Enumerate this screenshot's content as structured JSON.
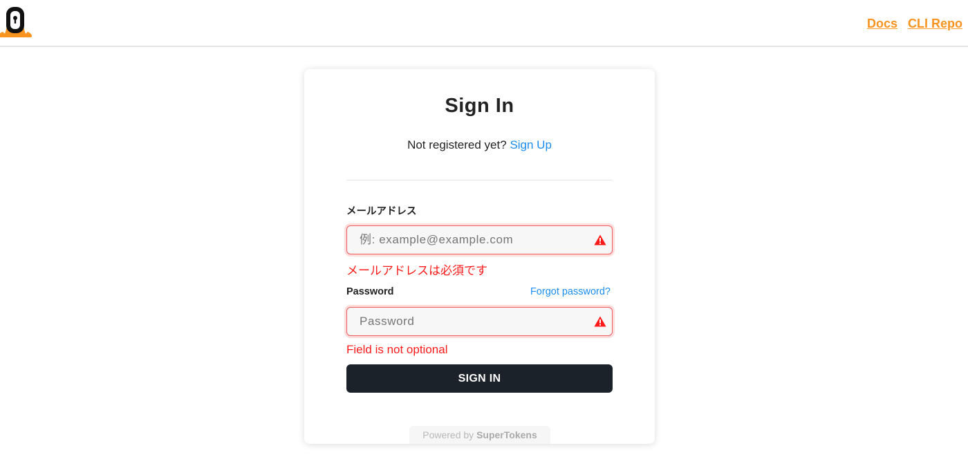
{
  "header": {
    "logo": "supertokens-logo",
    "links": [
      {
        "label": "Docs"
      },
      {
        "label": "CLI Repo"
      }
    ]
  },
  "card": {
    "title": "Sign In",
    "subtitle_text": "Not registered yet?",
    "signup_link": "Sign Up",
    "email": {
      "label": "メールアドレス",
      "placeholder": "例: example@example.com",
      "value": "",
      "error": "メールアドレスは必須です"
    },
    "password": {
      "label": "Password",
      "placeholder": "Password",
      "value": "",
      "error": "Field is not optional",
      "forgot_link": "Forgot password?"
    },
    "submit_label": "SIGN IN",
    "powered_by_prefix": "Powered by",
    "powered_by_brand": "SuperTokens"
  },
  "colors": {
    "accent_orange": "#f7931e",
    "link_blue": "#1a8cf1",
    "error_red": "#ff1a1a",
    "button_dark": "#1c222a"
  },
  "icons": [
    "supertokens-logo",
    "warning-icon"
  ]
}
